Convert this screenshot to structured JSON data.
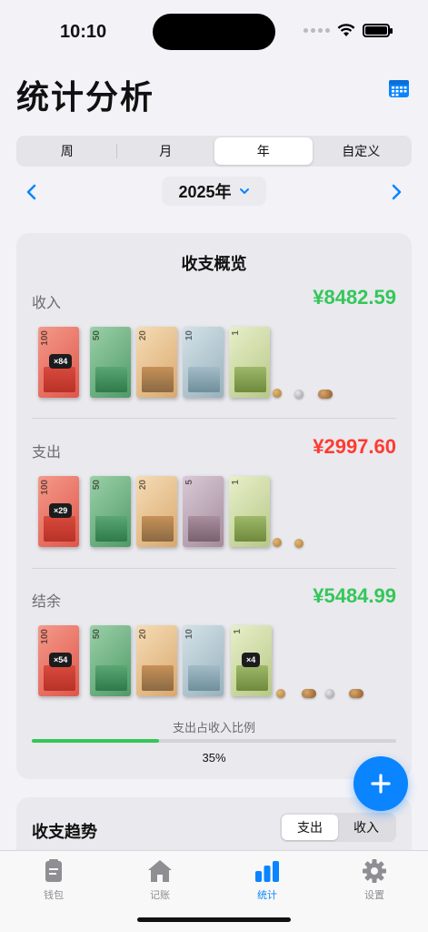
{
  "status": {
    "time": "10:10"
  },
  "header": {
    "title": "统计分析",
    "calendar_icon": "calendar-icon"
  },
  "periods": {
    "items": [
      "周",
      "月",
      "年",
      "自定义"
    ],
    "selected": "年"
  },
  "nav": {
    "year_label": "2025年"
  },
  "overview": {
    "title": "收支概览",
    "income": {
      "label": "收入",
      "amount": "¥8482.59",
      "color": "#34c759",
      "badge": "×84"
    },
    "expense": {
      "label": "支出",
      "amount": "¥2997.60",
      "color": "#ff3b30",
      "badge": "×29"
    },
    "balance": {
      "label": "结余",
      "amount": "¥5484.99",
      "color": "#34c759",
      "badge": "×54",
      "badge2": "×4"
    },
    "ratio": {
      "label": "支出占收入比例",
      "value_text": "35%",
      "fraction": 0.35
    }
  },
  "trend": {
    "title": "收支趋势",
    "options": [
      "支出",
      "收入"
    ],
    "selected": "支出"
  },
  "tabbar": {
    "items": [
      {
        "label": "钱包",
        "icon": "wallet-icon"
      },
      {
        "label": "记账",
        "icon": "house-icon"
      },
      {
        "label": "统计",
        "icon": "chart-icon"
      },
      {
        "label": "设置",
        "icon": "gear-icon"
      }
    ],
    "selected": "统计"
  },
  "colors": {
    "accent": "#0a84ff",
    "income": "#34c759",
    "expense": "#ff3b30"
  }
}
